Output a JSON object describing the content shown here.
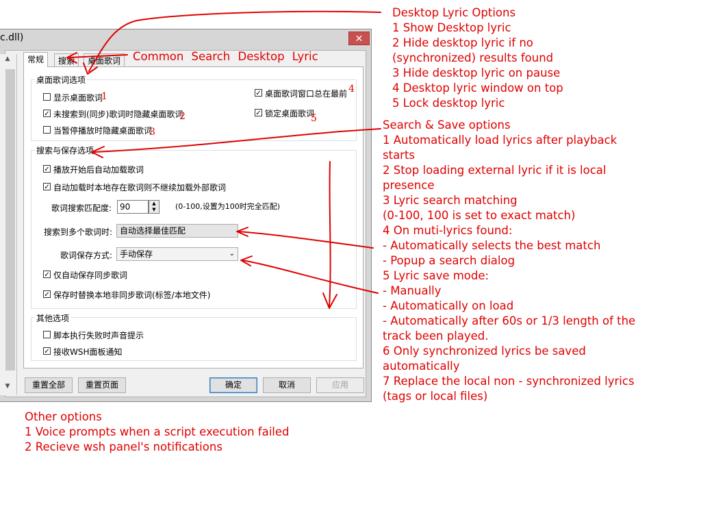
{
  "dialog": {
    "title": "c.dll)",
    "close_label": "✕",
    "tabs": [
      "常规",
      "搜索",
      "桌面歌词"
    ],
    "desktop_group": {
      "title": "桌面歌词选项",
      "items": [
        {
          "label": "显示桌面歌词",
          "checked": false,
          "num": "1"
        },
        {
          "label": "未搜索到(同步)歌词时隐藏桌面歌词",
          "checked": true,
          "num": "2"
        },
        {
          "label": "当暂停播放时隐藏桌面歌词",
          "checked": false,
          "num": "3"
        },
        {
          "label": "桌面歌词窗口总在最前",
          "checked": true,
          "num": "4"
        },
        {
          "label": "锁定桌面歌词",
          "checked": true,
          "num": "5"
        }
      ]
    },
    "search_group": {
      "title": "搜索与保存选项",
      "autoload_label": "播放开始后自动加载歌词",
      "stop_external_label": "自动加载时本地存在歌词则不继续加载外部歌词",
      "match_label": "歌词搜索匹配度:",
      "match_value": "90",
      "match_hint": "(0-100,设置为100时完全匹配)",
      "multi_label": "搜索到多个歌词时:",
      "multi_value": "自动选择最佳匹配",
      "save_mode_label": "歌词保存方式:",
      "save_mode_value": "手动保存",
      "only_sync_label": "仅自动保存同步歌词",
      "replace_label": "保存时替换本地非同步歌词(标签/本地文件)"
    },
    "other_group": {
      "title": "其他选项",
      "voice_label": "脚本执行失败时声音提示",
      "wsh_label": "接收WSH面板通知"
    },
    "buttons": {
      "reset_all": "重置全部",
      "reset_page": "重置页面",
      "ok": "确定",
      "cancel": "取消",
      "apply": "应用"
    }
  },
  "annotations": {
    "tab_names": "Common  Search  Desktop Lyric",
    "desktop_lyric_options": [
      "Desktop Lyric Options",
      "1 Show Desktop lyric",
      "2 Hide desktop lyric if no",
      "(synchronized) results found",
      "3 Hide desktop lyric on pause",
      "4 Desktop lyric window on top",
      "5 Lock desktop lyric"
    ],
    "search_save_options": [
      "Search & Save options",
      "1 Automatically load lyrics after playback",
      "starts",
      "2 Stop loading external lyric if it is  local",
      "presence",
      "3 Lyric search matching",
      "(0-100, 100 is set to exact match)",
      "4 On muti-lyrics found:",
      "- Automatically selects the best match",
      "- Popup a search dialog",
      "5 Lyric save mode:",
      "- Manually",
      "- Automatically on load",
      "- Automatically after 60s or 1/3 length of the",
      "track been played.",
      "6 Only synchronized lyrics be saved",
      "automatically",
      "7 Replace  the local non - synchronized lyrics",
      "(tags or local files)"
    ],
    "other_options": [
      "Other options",
      "1 Voice prompts when a script execution failed",
      "2 Recieve wsh panel's notifications"
    ],
    "color": "#e00000"
  }
}
